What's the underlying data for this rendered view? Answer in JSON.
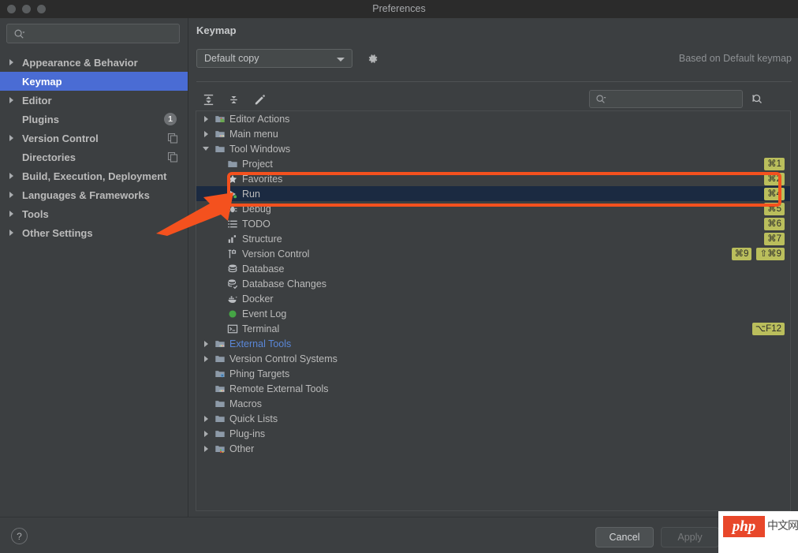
{
  "window": {
    "title": "Preferences",
    "traffic_lights": [
      "close-button",
      "minimize-button",
      "zoom-button"
    ]
  },
  "sidebar": {
    "search": {
      "value": "",
      "placeholder": "",
      "icon": "search-icon"
    },
    "items": [
      {
        "label": "Appearance & Behavior",
        "expandable": true,
        "selected": false,
        "badge": null,
        "trailing_icon": null
      },
      {
        "label": "Keymap",
        "expandable": false,
        "selected": true,
        "badge": null,
        "trailing_icon": null
      },
      {
        "label": "Editor",
        "expandable": true,
        "selected": false,
        "badge": null,
        "trailing_icon": null
      },
      {
        "label": "Plugins",
        "expandable": false,
        "selected": false,
        "badge": "1",
        "trailing_icon": null
      },
      {
        "label": "Version Control",
        "expandable": true,
        "selected": false,
        "badge": null,
        "trailing_icon": "copy-icon"
      },
      {
        "label": "Directories",
        "expandable": false,
        "selected": false,
        "badge": null,
        "trailing_icon": "copy-icon"
      },
      {
        "label": "Build, Execution, Deployment",
        "expandable": true,
        "selected": false,
        "badge": null,
        "trailing_icon": null
      },
      {
        "label": "Languages & Frameworks",
        "expandable": true,
        "selected": false,
        "badge": null,
        "trailing_icon": null
      },
      {
        "label": "Tools",
        "expandable": true,
        "selected": false,
        "badge": null,
        "trailing_icon": null
      },
      {
        "label": "Other Settings",
        "expandable": true,
        "selected": false,
        "badge": null,
        "trailing_icon": null
      }
    ]
  },
  "main": {
    "panel_title": "Keymap",
    "keymap_select": {
      "value": "Default copy"
    },
    "gear_button": "gear-icon",
    "based_on": "Based on Default keymap",
    "toolbar": {
      "expand_all": "expand-all-icon",
      "collapse_all": "collapse-all-icon",
      "edit": "pencil-icon",
      "find_actions": "find-shortcut-icon",
      "search": {
        "value": "",
        "placeholder": "",
        "icon": "search-icon"
      }
    },
    "tree": [
      {
        "label": "Editor Actions",
        "depth": 0,
        "toggle": "collapsed",
        "icon": "folder-editor-icon",
        "shortcuts": [],
        "selected": false,
        "link": false
      },
      {
        "label": "Main menu",
        "depth": 0,
        "toggle": "collapsed",
        "icon": "folder-menu-icon",
        "shortcuts": [],
        "selected": false,
        "link": false
      },
      {
        "label": "Tool Windows",
        "depth": 0,
        "toggle": "expanded",
        "icon": "folder-icon",
        "shortcuts": [],
        "selected": false,
        "link": false
      },
      {
        "label": "Project",
        "depth": 1,
        "toggle": "none",
        "icon": "folder-icon",
        "shortcuts": [
          "⌘1"
        ],
        "selected": false,
        "link": false
      },
      {
        "label": "Favorites",
        "depth": 1,
        "toggle": "none",
        "icon": "star-icon",
        "shortcuts": [
          "⌘2"
        ],
        "selected": false,
        "link": false
      },
      {
        "label": "Run",
        "depth": 1,
        "toggle": "none",
        "icon": "run-icon",
        "shortcuts": [
          "⌘4"
        ],
        "selected": true,
        "link": false
      },
      {
        "label": "Debug",
        "depth": 1,
        "toggle": "none",
        "icon": "debug-icon",
        "shortcuts": [
          "⌘5"
        ],
        "selected": false,
        "link": false
      },
      {
        "label": "TODO",
        "depth": 1,
        "toggle": "none",
        "icon": "todo-icon",
        "shortcuts": [
          "⌘6"
        ],
        "selected": false,
        "link": false
      },
      {
        "label": "Structure",
        "depth": 1,
        "toggle": "none",
        "icon": "structure-icon",
        "shortcuts": [
          "⌘7"
        ],
        "selected": false,
        "link": false
      },
      {
        "label": "Version Control",
        "depth": 1,
        "toggle": "none",
        "icon": "branch-icon",
        "shortcuts": [
          "⌘9",
          "⇧⌘9"
        ],
        "selected": false,
        "link": false
      },
      {
        "label": "Database",
        "depth": 1,
        "toggle": "none",
        "icon": "database-icon",
        "shortcuts": [],
        "selected": false,
        "link": false
      },
      {
        "label": "Database Changes",
        "depth": 1,
        "toggle": "none",
        "icon": "database-changes-icon",
        "shortcuts": [],
        "selected": false,
        "link": false
      },
      {
        "label": "Docker",
        "depth": 1,
        "toggle": "none",
        "icon": "docker-icon",
        "shortcuts": [],
        "selected": false,
        "link": false
      },
      {
        "label": "Event Log",
        "depth": 1,
        "toggle": "none",
        "icon": "event-log-icon",
        "shortcuts": [],
        "selected": false,
        "link": false
      },
      {
        "label": "Terminal",
        "depth": 1,
        "toggle": "none",
        "icon": "terminal-icon",
        "shortcuts": [
          "⌥F12"
        ],
        "selected": false,
        "link": false
      },
      {
        "label": "External Tools",
        "depth": 0,
        "toggle": "collapsed",
        "icon": "folder-tools-icon",
        "shortcuts": [],
        "selected": false,
        "link": true
      },
      {
        "label": "Version Control Systems",
        "depth": 0,
        "toggle": "collapsed",
        "icon": "folder-icon",
        "shortcuts": [],
        "selected": false,
        "link": false
      },
      {
        "label": "Phing Targets",
        "depth": 0,
        "toggle": "none",
        "icon": "folder-phing-icon",
        "shortcuts": [],
        "selected": false,
        "link": false
      },
      {
        "label": "Remote External Tools",
        "depth": 0,
        "toggle": "none",
        "icon": "folder-tools-icon",
        "shortcuts": [],
        "selected": false,
        "link": false
      },
      {
        "label": "Macros",
        "depth": 0,
        "toggle": "none",
        "icon": "folder-icon",
        "shortcuts": [],
        "selected": false,
        "link": false
      },
      {
        "label": "Quick Lists",
        "depth": 0,
        "toggle": "collapsed",
        "icon": "folder-icon",
        "shortcuts": [],
        "selected": false,
        "link": false
      },
      {
        "label": "Plug-ins",
        "depth": 0,
        "toggle": "collapsed",
        "icon": "folder-icon",
        "shortcuts": [],
        "selected": false,
        "link": false
      },
      {
        "label": "Other",
        "depth": 0,
        "toggle": "collapsed",
        "icon": "folder-other-icon",
        "shortcuts": [],
        "selected": false,
        "link": false
      }
    ]
  },
  "footer": {
    "help_label": "?",
    "cancel_label": "Cancel",
    "apply_label": "Apply"
  },
  "watermark": {
    "logo_text": "php",
    "site_text": "中文网"
  },
  "annotations": {
    "highlight_box": "red-rounded-rectangle",
    "pointer": "red-arrow"
  },
  "colors": {
    "window_bg": "#3c3f41",
    "titlebar_bg": "#2b2b2b",
    "sidebar_selected": "#4a6cd4",
    "tree_selected": "#1b2a41",
    "shortcut_badge": "#babe5c",
    "link_text": "#5a87d8",
    "annotation": "#f4511e",
    "php_logo": "#e8472a"
  }
}
